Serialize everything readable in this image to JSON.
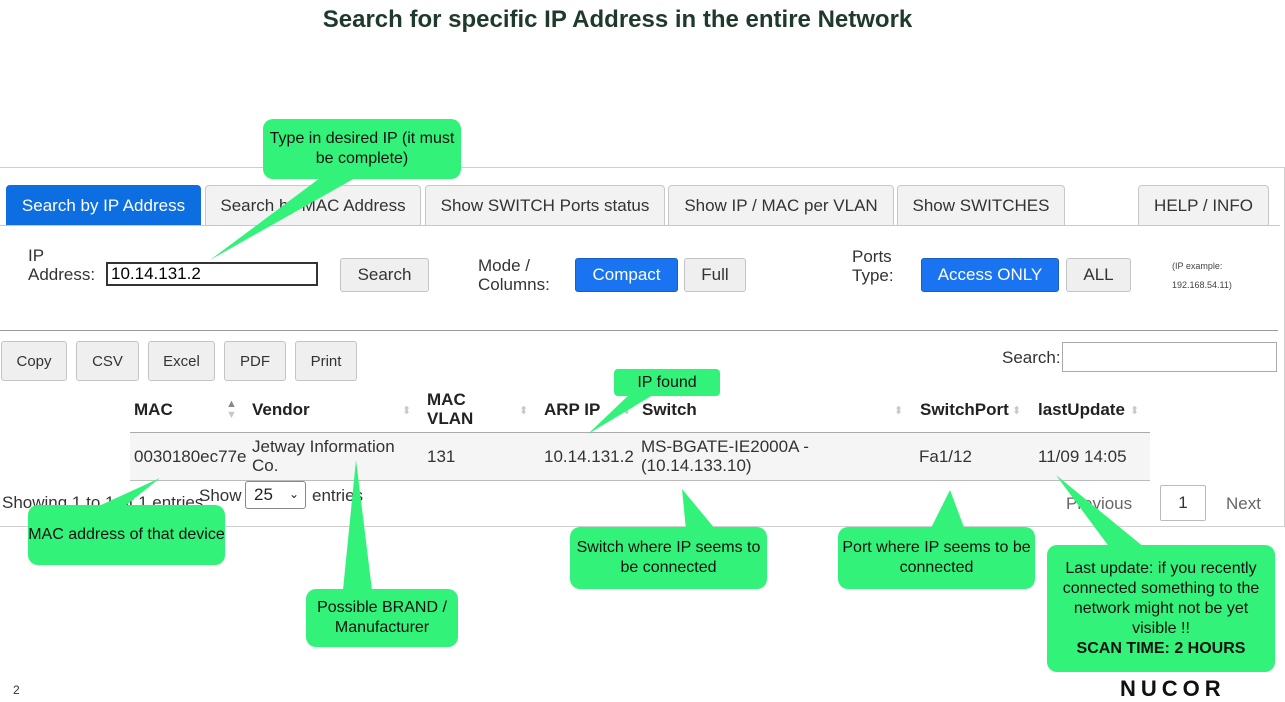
{
  "slide": {
    "title": "Search for specific IP Address in the entire Network",
    "page_number": "2",
    "logo_text": "NUCOR"
  },
  "tabs": [
    {
      "label": "Search by IP Address",
      "active": true
    },
    {
      "label": "Search by MAC Address",
      "active": false
    },
    {
      "label": "Show SWITCH Ports status",
      "active": false
    },
    {
      "label": "Show IP / MAC per VLAN",
      "active": false
    },
    {
      "label": "Show SWITCHES",
      "active": false
    },
    {
      "label": "HELP / INFO",
      "active": false
    }
  ],
  "form": {
    "ip_label_line1": "IP",
    "ip_label_line2": "Address:",
    "ip_value": "10.14.131.2",
    "search_button": "Search",
    "mode_label_line1": "Mode /",
    "mode_label_line2": "Columns:",
    "mode_compact": "Compact",
    "mode_full": "Full",
    "ports_label_line1": "Ports",
    "ports_label_line2": "Type:",
    "ports_access": "Access ONLY",
    "ports_all": "ALL",
    "ip_example_line1": "(IP example:",
    "ip_example_line2": "192.168.54.11)"
  },
  "export_buttons": [
    "Copy",
    "CSV",
    "Excel",
    "PDF",
    "Print"
  ],
  "table_search_label": "Search:",
  "table": {
    "headers": {
      "mac": "MAC",
      "vendor": "Vendor",
      "mac_vlan_line1": "MAC",
      "mac_vlan_line2": "VLAN",
      "arp_ip": "ARP IP",
      "switch": "Switch",
      "switch_port": "SwitchPort",
      "last_update": "lastUpdate"
    },
    "row": {
      "mac": "0030180ec77e",
      "vendor_line1": "Jetway Information",
      "vendor_line2": "Co.",
      "mac_vlan": "131",
      "arp_ip": "10.14.131.2",
      "switch_line1": "MS-BGATE-IE2000A -",
      "switch_line2": "(10.14.133.10)",
      "switch_port": "Fa1/12",
      "last_update": "11/09 14:05"
    }
  },
  "footer": {
    "showing": "Showing 1 to 1 of 1 entries",
    "show_label": "Show",
    "page_length": "25",
    "entries_label": "entries",
    "previous": "Previous",
    "current_page": "1",
    "next": "Next"
  },
  "callouts": {
    "type_ip": "Type in desired IP (it must be complete)",
    "ip_found": "IP found",
    "mac_device": "MAC address of that device",
    "brand": "Possible BRAND / Manufacturer",
    "switch_where": "Switch where IP seems to be connected",
    "port_where": "Port  where IP seems to be connected",
    "last_update_line1": "Last update: if you recently connected something to the network might not be yet visible !!",
    "last_update_line2": "SCAN TIME: 2 HOURS"
  },
  "colors": {
    "active_tab": "#0c6ee0",
    "primary_button": "#1a73f0",
    "callout": "#33f27a",
    "title": "#1f3a2c"
  }
}
